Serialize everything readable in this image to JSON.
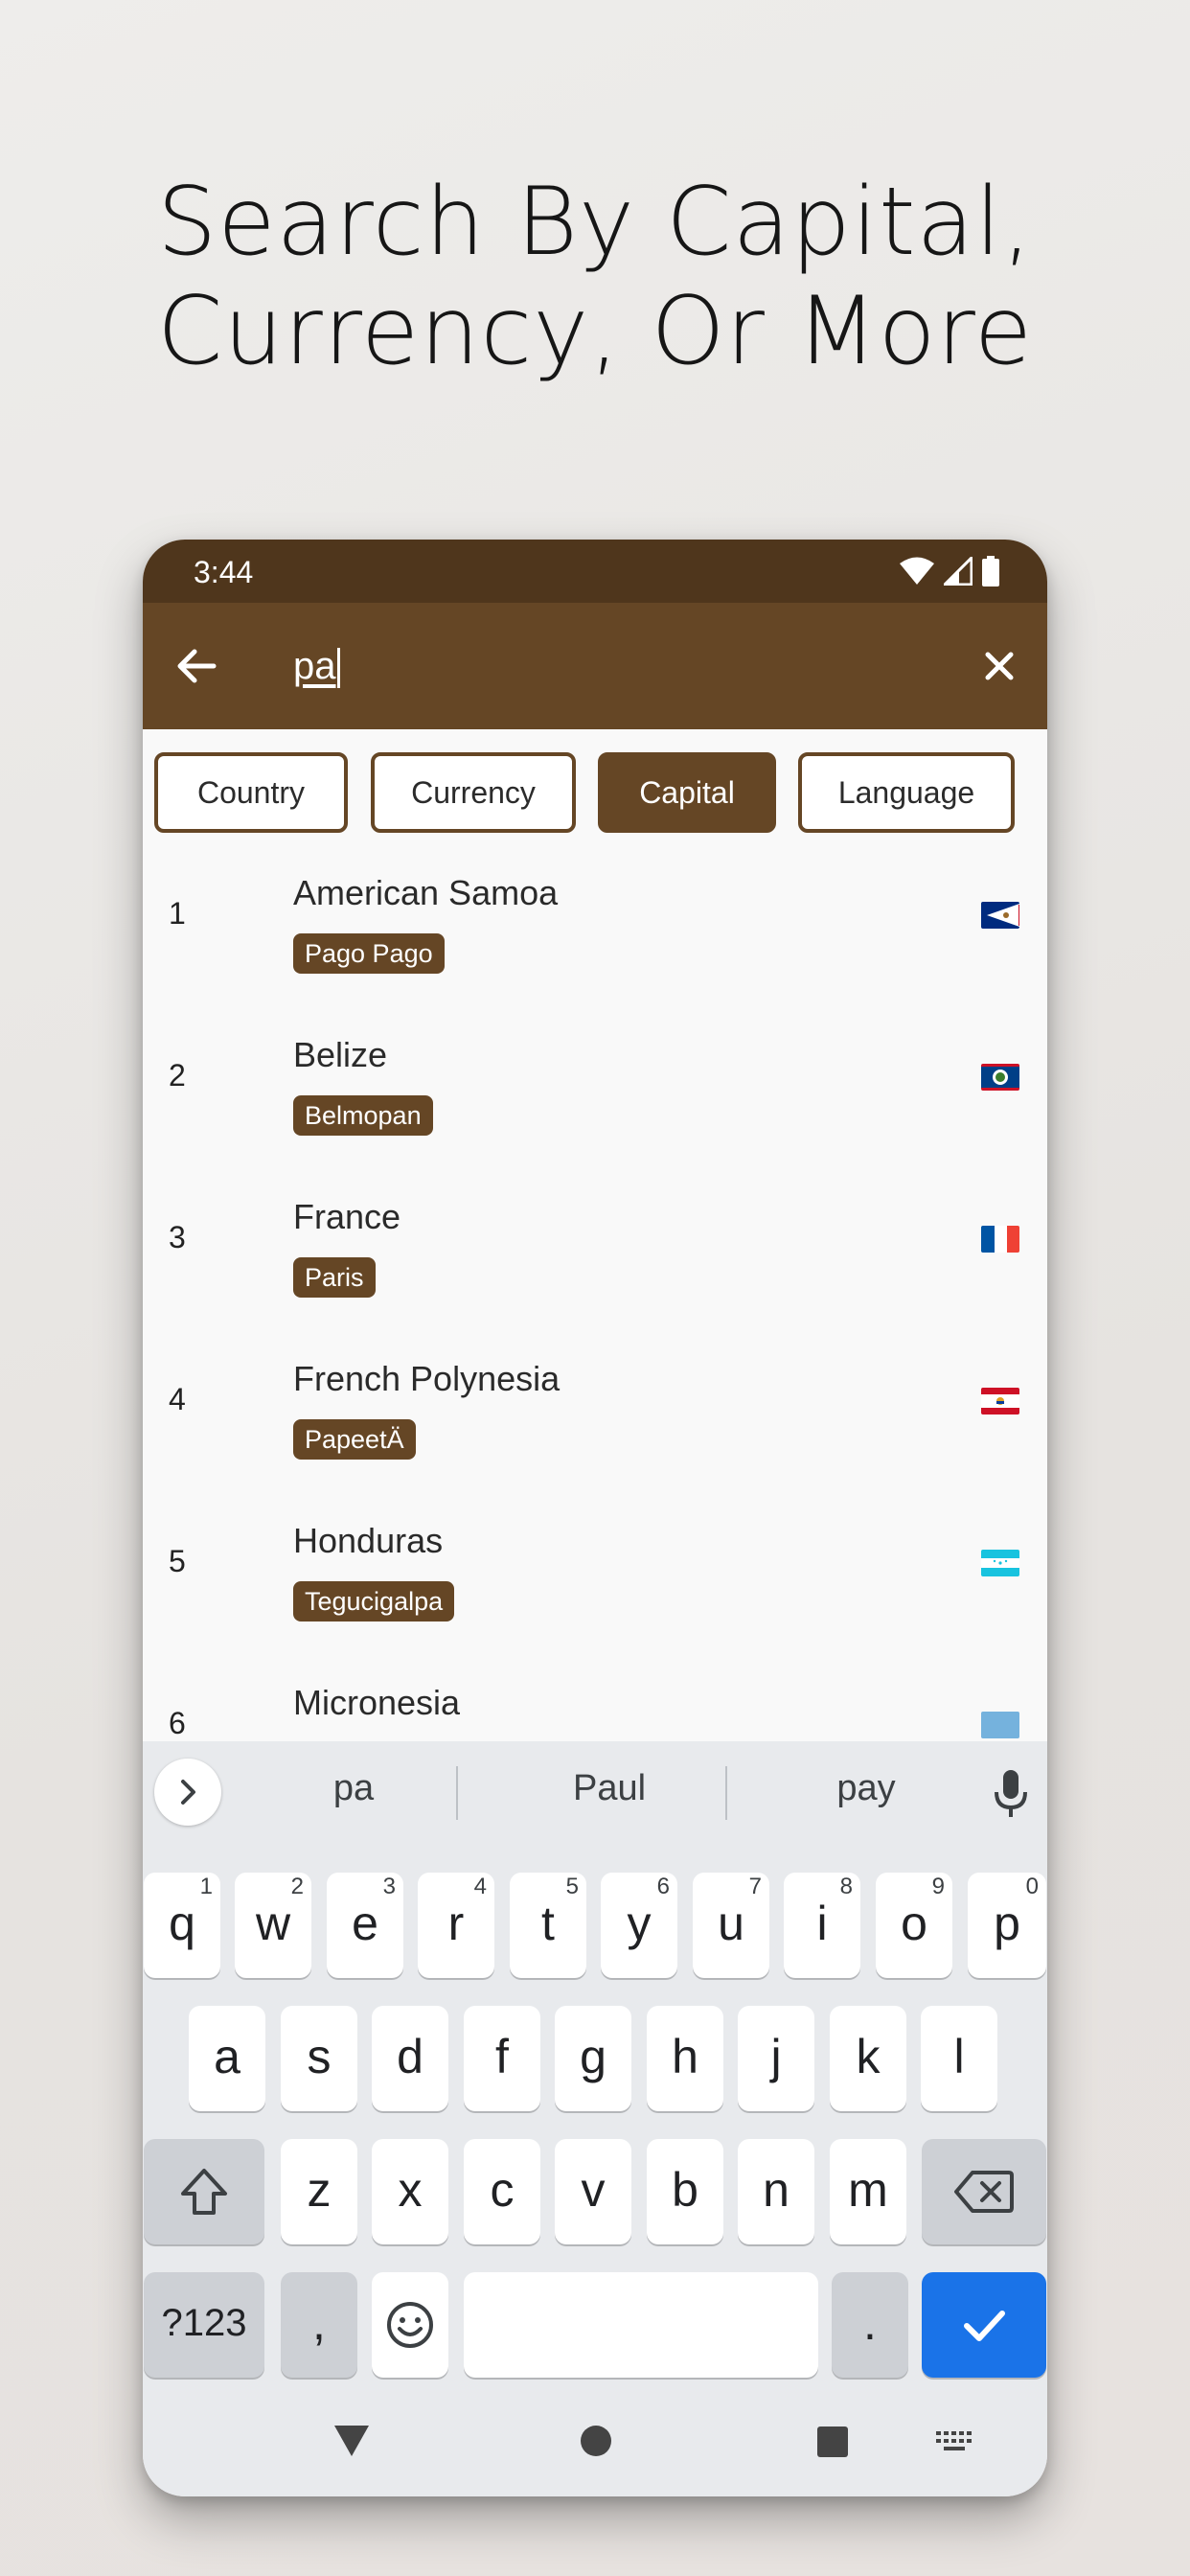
{
  "headline": {
    "line1": "Search By Capital,",
    "line2": "Currency, Or More"
  },
  "status_bar": {
    "time": "3:44",
    "icons": [
      "wifi-icon",
      "signal-icon",
      "battery-icon"
    ]
  },
  "app_bar": {
    "back_icon": "arrow-back-icon",
    "query": "pa",
    "clear_icon": "close-icon"
  },
  "filters": [
    {
      "label": "Country",
      "active": false
    },
    {
      "label": "Currency",
      "active": false
    },
    {
      "label": "Capital",
      "active": true
    },
    {
      "label": "Language",
      "active": false
    }
  ],
  "results": [
    {
      "index": "1",
      "country": "American Samoa",
      "capital": "Pago Pago",
      "flag": "american-samoa-flag-icon"
    },
    {
      "index": "2",
      "country": "Belize",
      "capital": "Belmopan",
      "flag": "belize-flag-icon"
    },
    {
      "index": "3",
      "country": "France",
      "capital": "Paris",
      "flag": "france-flag-icon"
    },
    {
      "index": "4",
      "country": "French Polynesia",
      "capital": "PapeetÄ",
      "flag": "french-polynesia-flag-icon"
    },
    {
      "index": "5",
      "country": "Honduras",
      "capital": "Tegucigalpa",
      "flag": "honduras-flag-icon"
    },
    {
      "index": "6",
      "country": "Micronesia",
      "capital": "",
      "flag": "micronesia-flag-icon"
    }
  ],
  "keyboard": {
    "suggestions": [
      "pa",
      "Paul",
      "pay"
    ],
    "row1": [
      {
        "k": "q",
        "h": "1"
      },
      {
        "k": "w",
        "h": "2"
      },
      {
        "k": "e",
        "h": "3"
      },
      {
        "k": "r",
        "h": "4"
      },
      {
        "k": "t",
        "h": "5"
      },
      {
        "k": "y",
        "h": "6"
      },
      {
        "k": "u",
        "h": "7"
      },
      {
        "k": "i",
        "h": "8"
      },
      {
        "k": "o",
        "h": "9"
      },
      {
        "k": "p",
        "h": "0"
      }
    ],
    "row2": [
      "a",
      "s",
      "d",
      "f",
      "g",
      "h",
      "j",
      "k",
      "l"
    ],
    "row3": [
      "z",
      "x",
      "c",
      "v",
      "b",
      "n",
      "m"
    ],
    "symbols_label": "?123",
    "comma": ",",
    "period": "."
  },
  "colors": {
    "primary": "#654625",
    "primary_dark": "#4f361c",
    "key_action": "#1a73e8"
  }
}
